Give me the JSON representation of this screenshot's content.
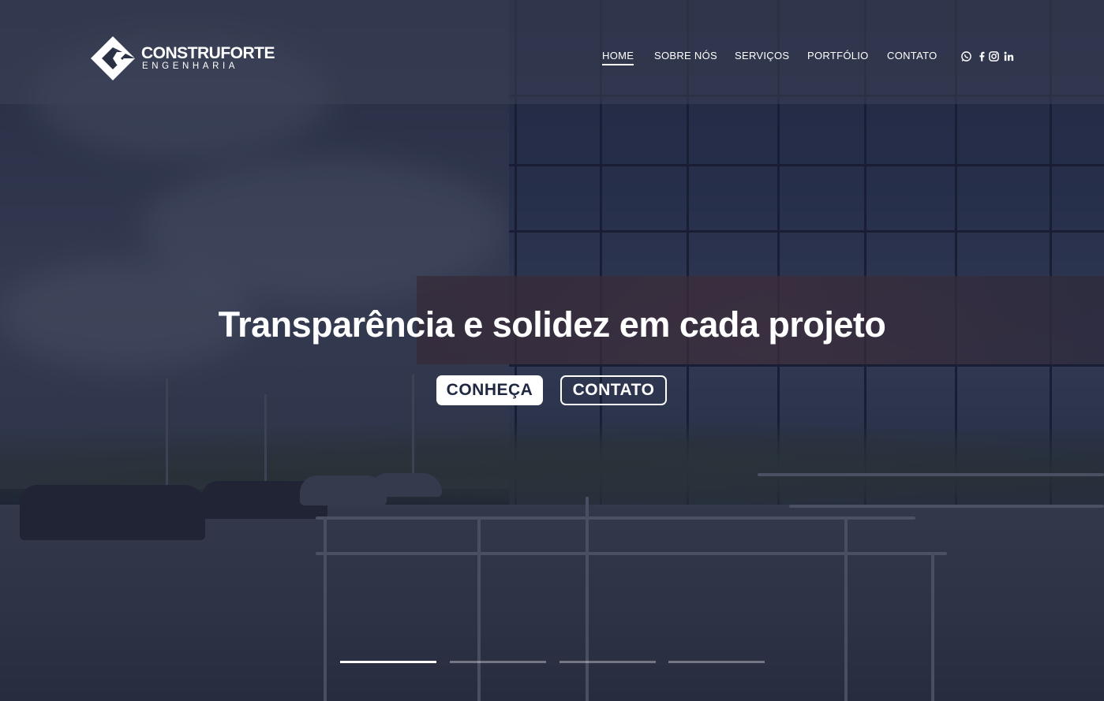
{
  "brand": {
    "name": "CONSTRUFORTE",
    "subtitle": "ENGENHARIA"
  },
  "nav": {
    "items": [
      {
        "label": "HOME",
        "active": true
      },
      {
        "label": "SOBRE NÓS",
        "active": false
      },
      {
        "label": "SERVIÇOS",
        "active": false
      },
      {
        "label": "PORTFÓLIO",
        "active": false
      },
      {
        "label": "CONTATO",
        "active": false
      }
    ]
  },
  "social": {
    "icons": [
      "whatsapp-icon",
      "facebook-icon",
      "instagram-icon",
      "linkedin-icon"
    ]
  },
  "hero": {
    "title": "Transparência e solidez em cada projeto",
    "primary_button": "CONHEÇA",
    "secondary_button": "CONTATO"
  },
  "slider": {
    "slide_count": 4,
    "active_index": 0
  },
  "colors": {
    "overlay": "#181e34",
    "button_text": "#1e2742",
    "text": "#ffffff"
  }
}
